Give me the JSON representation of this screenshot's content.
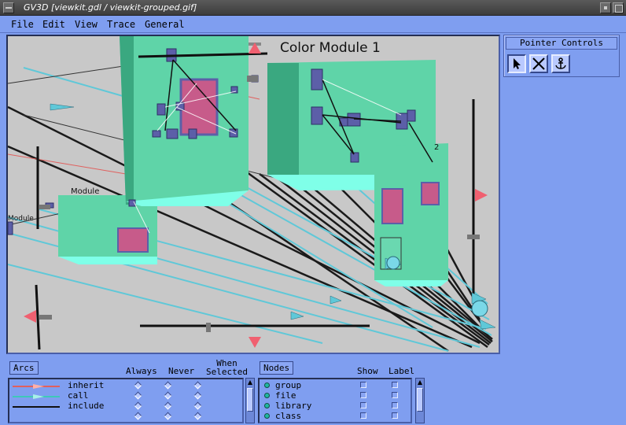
{
  "window": {
    "title": "GV3D [viewkit.gdl / viewkit-grouped.gif]"
  },
  "menu": {
    "items": [
      "File",
      "Edit",
      "View",
      "Trace",
      "General"
    ]
  },
  "viewport": {
    "module_title": "Color Module 1",
    "labels": [
      "2",
      "Module",
      "Module"
    ]
  },
  "pointer_controls": {
    "title": "Pointer Controls",
    "tools": [
      "select-arrow-icon",
      "cross-icon",
      "anchor-icon"
    ]
  },
  "arcs": {
    "label": "Arcs",
    "columns": [
      "Always",
      "Never",
      "When\nSelected"
    ],
    "rows": [
      {
        "name": "inherit",
        "color": "#e0605e"
      },
      {
        "name": "call",
        "color": "#3ec8b8"
      },
      {
        "name": "include",
        "color": "#111111"
      }
    ]
  },
  "nodes": {
    "label": "Nodes",
    "columns": [
      "Show",
      "Label"
    ],
    "rows": [
      "group",
      "file",
      "library",
      "class"
    ]
  },
  "colors": {
    "panel": "#7f9ef0",
    "viewport_bg": "#c8c8c8",
    "module_box": "#5fd4a8",
    "node": "#5c5fa8",
    "arrow": "#f06070"
  }
}
